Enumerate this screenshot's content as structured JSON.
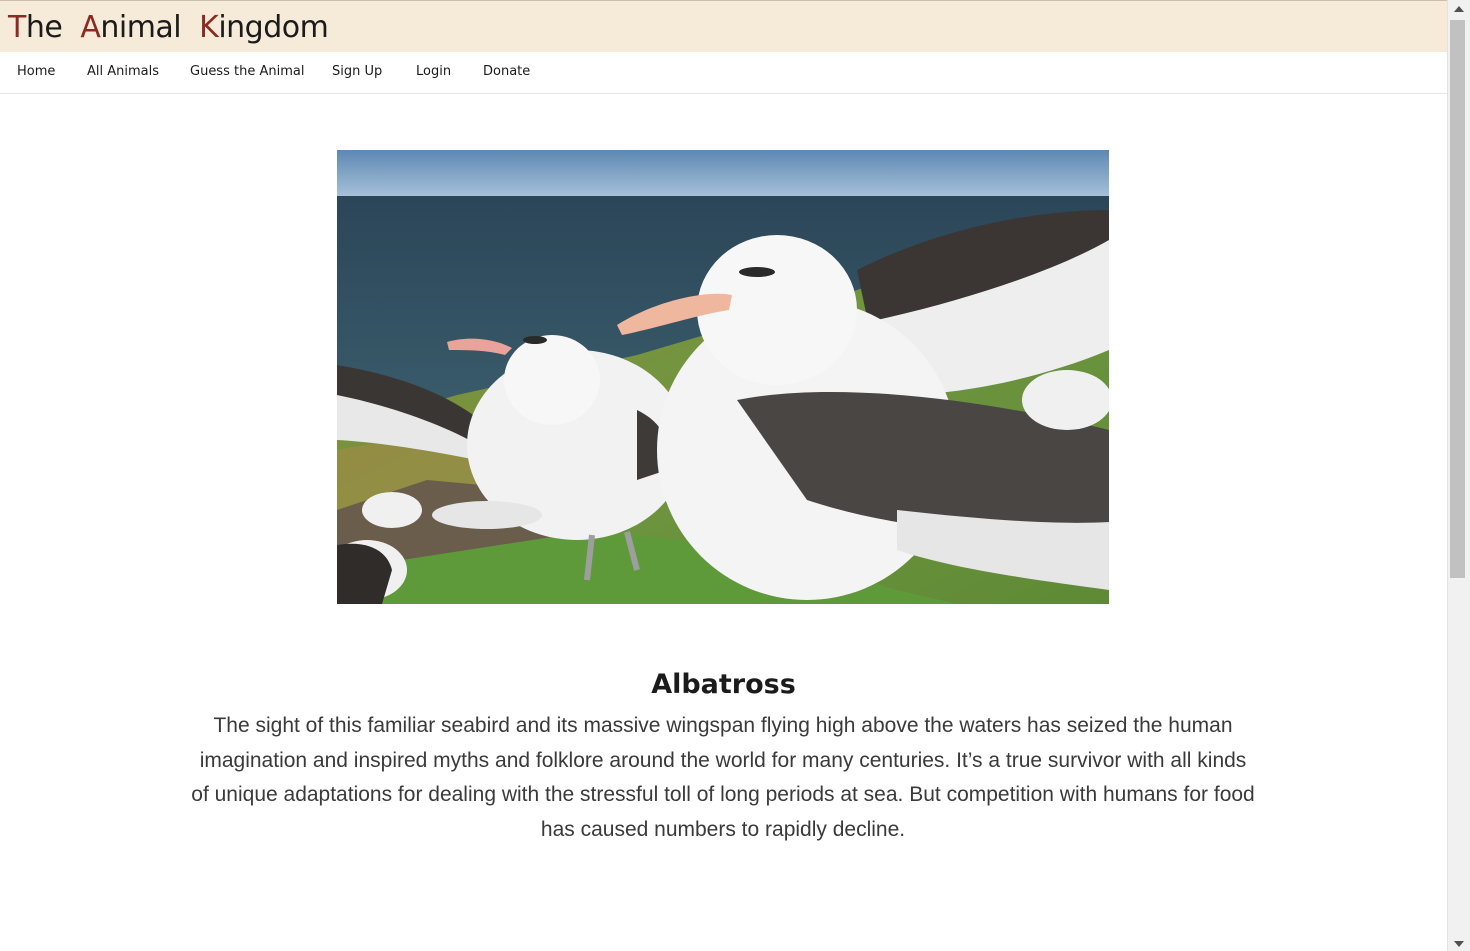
{
  "site": {
    "title_words": [
      {
        "cap": "T",
        "rest": "he"
      },
      {
        "cap": "A",
        "rest": "nimal"
      },
      {
        "cap": "K",
        "rest": "ingdom"
      }
    ]
  },
  "nav": {
    "items": [
      {
        "label": "Home"
      },
      {
        "label": "All Animals"
      },
      {
        "label": "Guess the Animal"
      },
      {
        "label": "Sign Up"
      },
      {
        "label": "Login"
      },
      {
        "label": "Donate"
      }
    ]
  },
  "hero": {
    "image_subject": "albatross-photo"
  },
  "animal": {
    "name": "Albatross",
    "description": "The sight of this familiar seabird and its massive wingspan flying high above the waters has seized the human imagination and inspired myths and folklore around the world for many centuries. It’s a true survivor with all kinds of unique adaptations for dealing with the stressful toll of long periods at sea. But competition with humans for food has caused numbers to rapidly decline."
  },
  "colors": {
    "header_bg": "#f6ebd9",
    "title_accent": "#8b2a22",
    "text": "#1b1b1b"
  }
}
